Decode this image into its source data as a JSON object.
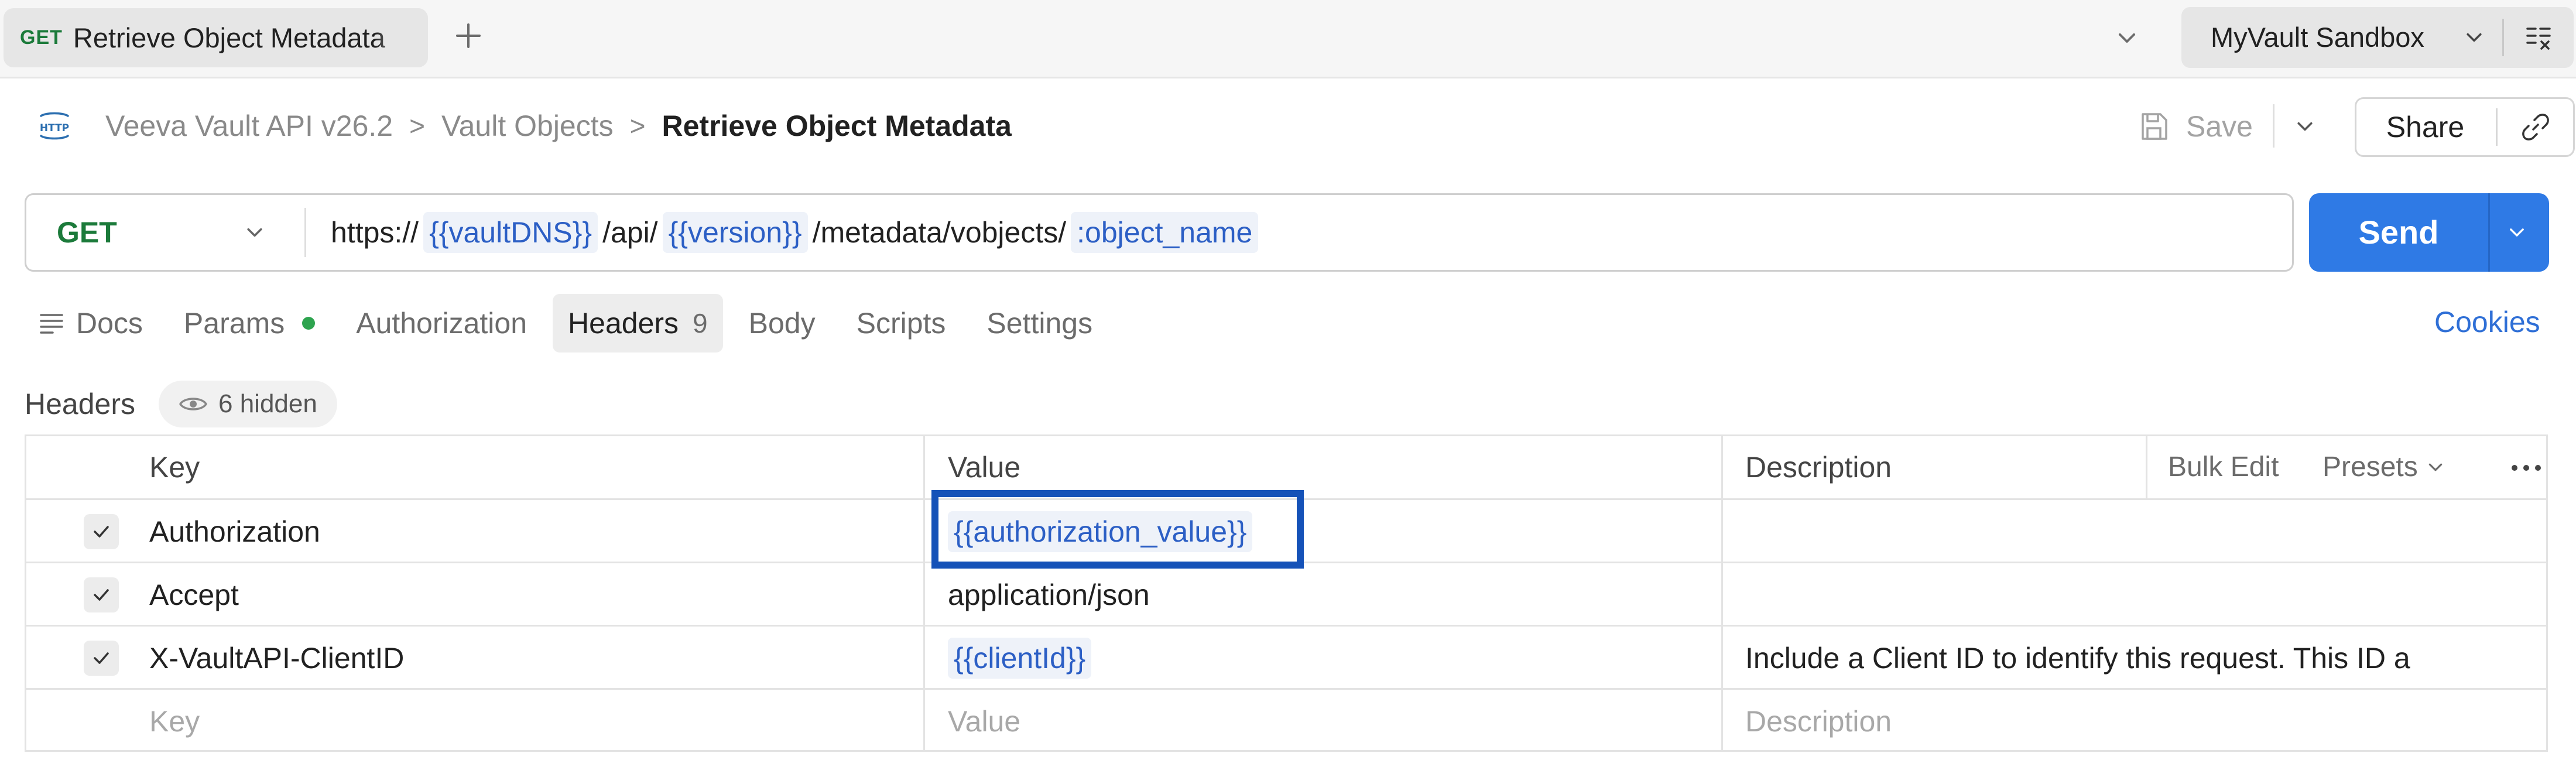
{
  "tab": {
    "method": "GET",
    "title": "Retrieve Object Metadata"
  },
  "environment": {
    "name": "MyVault Sandbox"
  },
  "breadcrumb": {
    "items": [
      "Veeva Vault API v26.2",
      "Vault Objects"
    ],
    "current": "Retrieve Object Metadata",
    "separator": ">"
  },
  "actions": {
    "save_label": "Save",
    "share_label": "Share"
  },
  "request": {
    "method": "GET",
    "url_parts": {
      "p1": "https://",
      "v1": "{{vaultDNS}}",
      "p2": "/api/",
      "v2": "{{version}}",
      "p3": "/metadata/vobjects/",
      "v3": ":object_name"
    },
    "send_label": "Send"
  },
  "subtabs": {
    "docs": "Docs",
    "params": "Params",
    "authorization": "Authorization",
    "headers": "Headers",
    "headers_count": "9",
    "body": "Body",
    "scripts": "Scripts",
    "settings": "Settings",
    "active": "headers",
    "params_status_color": "#2ea44f"
  },
  "cookies_label": "Cookies",
  "headers_section": {
    "label": "Headers",
    "hidden_label": "6 hidden",
    "columns": {
      "key": "Key",
      "value": "Value",
      "description": "Description"
    },
    "bulk_edit_label": "Bulk Edit",
    "presets_label": "Presets",
    "rows": [
      {
        "checked": true,
        "key": "Authorization",
        "value": "{{authorization_value}}",
        "value_is_variable": true,
        "description": ""
      },
      {
        "checked": true,
        "key": "Accept",
        "value": "application/json",
        "value_is_variable": false,
        "description": ""
      },
      {
        "checked": true,
        "key": "X-VaultAPI-ClientID",
        "value": "{{clientId}}",
        "value_is_variable": true,
        "description": "Include a Client ID to identify this request. This ID a"
      }
    ],
    "new_row_placeholders": {
      "key": "Key",
      "value": "Value",
      "description": "Description"
    }
  },
  "colors": {
    "method_green": "#1b7a3a",
    "send_blue": "#2f7ae5",
    "variable_blue": "#2c5fc5",
    "highlight_box": "#1552b8"
  }
}
